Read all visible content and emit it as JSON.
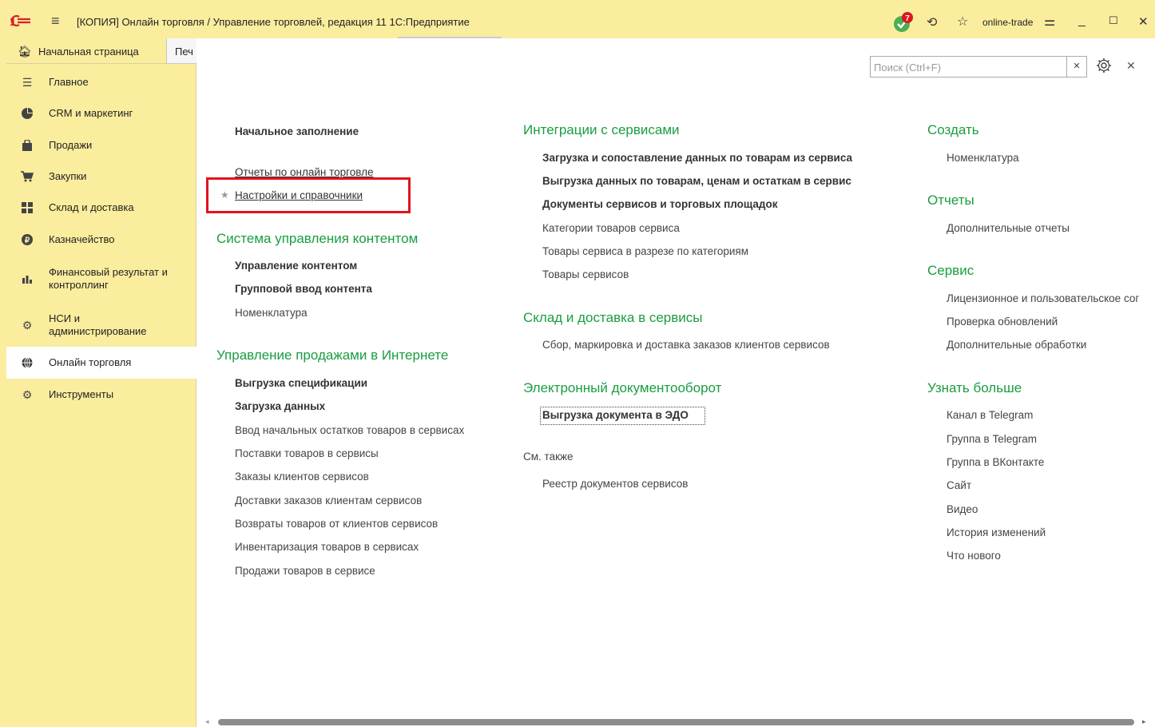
{
  "window": {
    "title": "[КОПИЯ] Онлайн торговля / Управление торговлей, редакция 11 1С:Предприятие",
    "user": "online-trade",
    "notification_count": "7"
  },
  "tabs": {
    "home": "Начальная страница",
    "second": "Печ"
  },
  "sidebar": {
    "items": [
      {
        "label": "Главное",
        "icon": "menu-lines-icon"
      },
      {
        "label": "CRM и маркетинг",
        "icon": "pie-chart-icon"
      },
      {
        "label": "Продажи",
        "icon": "shopping-bag-icon"
      },
      {
        "label": "Закупки",
        "icon": "cart-icon"
      },
      {
        "label": "Склад и доставка",
        "icon": "warehouse-grid-icon"
      },
      {
        "label": "Казначейство",
        "icon": "coin-icon"
      },
      {
        "label": "Финансовый результат и контроллинг",
        "icon": "bar-chart-icon"
      },
      {
        "label": "НСИ и администрирование",
        "icon": "gear-icon"
      },
      {
        "label": "Онлайн торговля",
        "icon": "globe-icon"
      },
      {
        "label": "Инструменты",
        "icon": "tools-icon"
      }
    ],
    "active_index": 8
  },
  "search": {
    "placeholder": "Поиск (Ctrl+F)"
  },
  "col1": {
    "initial_fill": "Начальное заполнение",
    "reports_online": "Отчеты по онлайн торговле",
    "settings_refs": "Настройки и справочники",
    "cms_title": "Система управления контентом",
    "cms_links": [
      "Управление контентом",
      "Групповой ввод контента",
      "Номенклатура"
    ],
    "sales_title": "Управление продажами в Интернете",
    "sales_links": [
      "Выгрузка спецификации",
      "Загрузка данных",
      "Ввод начальных остатков товаров в сервисах",
      "Поставки товаров в сервисы",
      "Заказы клиентов сервисов",
      "Доставки заказов клиентам сервисов",
      "Возвраты товаров от клиентов сервисов",
      "Инвентаризация товаров в сервисах",
      "Продажи товаров в сервисе"
    ]
  },
  "col2": {
    "integr_title": "Интеграции с сервисами",
    "integr_links": [
      "Загрузка и сопоставление данных по товарам из сервиса",
      "Выгрузка данных по товарам, ценам и остаткам в сервис",
      "Документы сервисов и торговых площадок",
      "Категории товаров сервиса",
      "Товары сервиса в разрезе по категориям",
      "Товары сервисов"
    ],
    "warehouse_title": "Склад и доставка в сервисы",
    "warehouse_links": [
      "Сбор, маркировка и доставка заказов клиентов сервисов"
    ],
    "edo_title": "Электронный документооборот",
    "edo_links": [
      "Выгрузка документа в ЭДО"
    ],
    "see_also": "См. также",
    "see_also_links": [
      "Реестр документов сервисов"
    ]
  },
  "col3": {
    "create_title": "Создать",
    "create_links": [
      "Номенклатура"
    ],
    "reports_title": "Отчеты",
    "reports_links": [
      "Дополнительные отчеты"
    ],
    "service_title": "Сервис",
    "service_links": [
      "Лицензионное и пользовательское сог",
      "Проверка обновлений",
      "Дополнительные обработки"
    ],
    "more_title": "Узнать больше",
    "more_links": [
      "Канал в Telegram",
      "Группа в Telegram",
      "Группа в ВКонтакте",
      "Сайт",
      "Видео",
      "История изменений",
      "Что нового"
    ]
  },
  "colors": {
    "accent_yellow": "#fbed9e",
    "section_green": "#1a9d3f",
    "highlight_red": "#e0141e",
    "notification_badge": "#e0141e",
    "notification_icon": "#4caf50"
  }
}
